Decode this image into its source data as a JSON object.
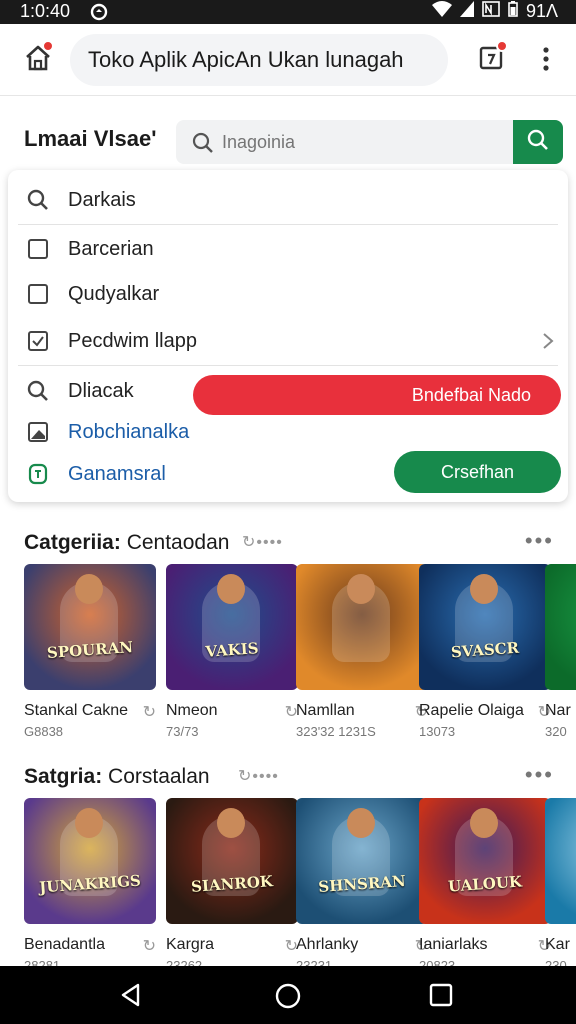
{
  "status_bar": {
    "time": "1:0:40",
    "right_text": "91Λ"
  },
  "app_bar": {
    "title": "Toko Aplik ApicAn Ukan lunagah"
  },
  "search": {
    "section_label": "Lmaai Vlsae'",
    "placeholder": "Inagoinia"
  },
  "dropdown": {
    "items": [
      {
        "label": "Darkais",
        "icon": "search-icon"
      },
      {
        "label": "Barcerian",
        "icon": "checkbox-empty-icon"
      },
      {
        "label": "Qudyalkar",
        "icon": "checkbox-empty-icon"
      },
      {
        "label": "Pecdwim llapp",
        "icon": "checkbox-checked-icon"
      },
      {
        "label": "Dliacak",
        "icon": "search-icon"
      },
      {
        "label": "Robchianalka",
        "icon": "image-icon"
      },
      {
        "label": "Ganamsral",
        "icon": "shield-icon"
      }
    ],
    "red_button": "Bndefbai Nado",
    "green_button": "Crsefhan"
  },
  "sections": [
    {
      "title_bold": "Catgeriia:",
      "title_rest": "Centaodan",
      "cards": [
        {
          "name": "Stankal Cakne",
          "sub": "G8838",
          "art": "SPOURAN",
          "colors": [
            "#3b3f6e",
            "#d0632a"
          ]
        },
        {
          "name": "Nmeon",
          "sub": "73/73",
          "art": "VAKIS",
          "colors": [
            "#4a1f73",
            "#1f4e8c"
          ]
        },
        {
          "name": "Namllan",
          "sub": "323'32 1231S",
          "art": "",
          "colors": [
            "#e0892a",
            "#6a3a1c"
          ]
        },
        {
          "name": "Rapelie Olaiga",
          "sub": "13073",
          "art": "SVASCR",
          "colors": [
            "#0f2f5c",
            "#2a6db0"
          ]
        },
        {
          "name": "Nar",
          "sub": "320",
          "art": "",
          "colors": [
            "#0c6b2a",
            "#1a9b46"
          ]
        }
      ]
    },
    {
      "title_bold": "Satgria:",
      "title_rest": "Corstaalan",
      "cards": [
        {
          "name": "Benadantla",
          "sub": "28281",
          "art": "JUNAKRIGS",
          "colors": [
            "#5a3a8c",
            "#d4a53a"
          ]
        },
        {
          "name": "Kargra",
          "sub": "23262",
          "art": "SIANROK",
          "colors": [
            "#2a1a12",
            "#8a2a1a"
          ]
        },
        {
          "name": "Ahrlanky",
          "sub": "23231",
          "art": "SHNSRAN",
          "colors": [
            "#1d4f74",
            "#6aa4c8"
          ]
        },
        {
          "name": "Ianiarlaks",
          "sub": "20823",
          "art": "UALOUK",
          "colors": [
            "#c8321a",
            "#3a1a5a"
          ]
        },
        {
          "name": "Kar",
          "sub": "230",
          "art": "",
          "colors": [
            "#1a7aa8",
            "#9ad0e8"
          ]
        }
      ]
    }
  ]
}
